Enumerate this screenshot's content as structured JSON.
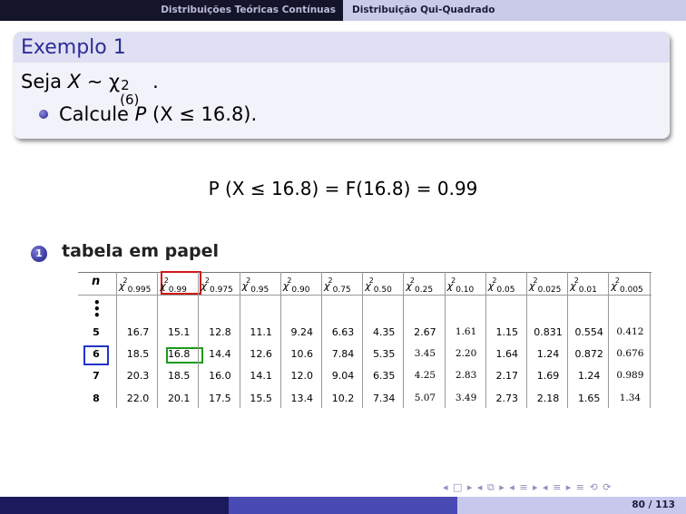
{
  "header": {
    "section": "Distribuições Teóricas Contínuas",
    "subsection": "Distribuição Qui-Quadrado"
  },
  "example": {
    "title": "Exemplo 1",
    "line1_prefix": "Seja ",
    "var": "X",
    "sim": " ∼ χ",
    "sup": "2",
    "sub": "(6)",
    "line1_suffix": ".",
    "bullet_text": "Calcule ",
    "bullet_expr_p": "P",
    "bullet_expr_rest": "(X ≤ 16.8)."
  },
  "formula": "P (X ≤ 16.8) = F(16.8) = 0.99",
  "method": {
    "number": "1",
    "label": "tabela em papel"
  },
  "table": {
    "n_header": "n",
    "col_headers": [
      "0.995",
      "0.99",
      "0.975",
      "0.95",
      "0.90",
      "0.75",
      "0.50",
      "0.25",
      "0.10",
      "0.05",
      "0.025",
      "0.01",
      "0.005"
    ],
    "rows": [
      {
        "n": "5",
        "values": [
          "16.7",
          "15.1",
          "12.8",
          "11.1",
          "9.24",
          "6.63",
          "4.35",
          "2.67",
          "1.61",
          "1.15",
          "0.831",
          "0.554",
          "0.412"
        ]
      },
      {
        "n": "6",
        "values": [
          "18.5",
          "16.8",
          "14.4",
          "12.6",
          "10.6",
          "7.84",
          "5.35",
          "3.45",
          "2.20",
          "1.64",
          "1.24",
          "0.872",
          "0.676"
        ]
      },
      {
        "n": "7",
        "values": [
          "20.3",
          "18.5",
          "16.0",
          "14.1",
          "12.0",
          "9.04",
          "6.35",
          "4.25",
          "2.83",
          "2.17",
          "1.69",
          "1.24",
          "0.989"
        ]
      },
      {
        "n": "8",
        "values": [
          "22.0",
          "20.1",
          "17.5",
          "15.5",
          "13.4",
          "10.2",
          "7.34",
          "5.07",
          "3.49",
          "2.73",
          "2.18",
          "1.65",
          "1.34"
        ]
      }
    ],
    "serif_cells": {
      "0": [
        8,
        12
      ],
      "1": [
        7,
        8,
        12
      ],
      "2": [
        7,
        8,
        12
      ],
      "3": [
        7,
        8,
        12
      ]
    }
  },
  "nav": {
    "symbols": "◂ □ ▸ ◂ ⧉ ▸ ◂ ≡ ▸ ◂ ≡ ▸  ≡  ⟲ ⟳"
  },
  "footer": {
    "page": "80 / 113"
  },
  "colors": {
    "accent": "#2c2c96",
    "highlight_red": "#d01818",
    "highlight_blue": "#2233cc",
    "highlight_green": "#1a9a1a"
  }
}
